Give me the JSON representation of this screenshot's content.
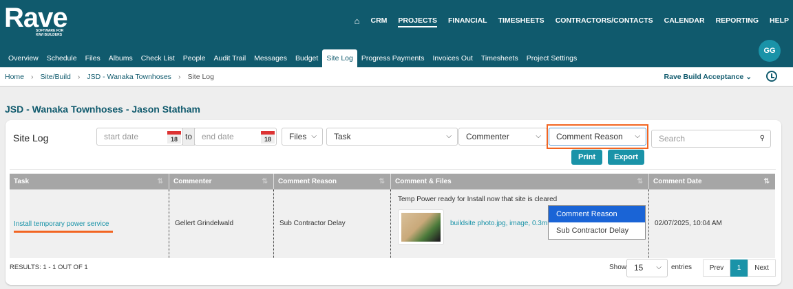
{
  "header": {
    "logo": "Rave",
    "logo_tagline": "SOFTWARE FOR KIWI BUILDERS",
    "top_nav": [
      "CRM",
      "PROJECTS",
      "FINANCIAL",
      "TIMESHEETS",
      "CONTRACTORS/CONTACTS",
      "CALENDAR",
      "REPORTING",
      "HELP"
    ],
    "active_top": "PROJECTS",
    "avatar": "GG"
  },
  "tabs": [
    "Overview",
    "Schedule",
    "Files",
    "Albums",
    "Check List",
    "People",
    "Audit Trail",
    "Messages",
    "Budget",
    "Site Log",
    "Progress Payments",
    "Invoices Out",
    "Timesheets",
    "Project Settings"
  ],
  "breadcrumb": [
    "Home",
    "Site/Build",
    "JSD - Wanaka Townhoses",
    "Site Log"
  ],
  "project_selector": "Rave Build Acceptance",
  "page_title": "JSD - Wanaka Townhoses - Jason Statham",
  "site_log": {
    "title": "Site Log",
    "start_placeholder": "start date",
    "to": "to",
    "end_placeholder": "end date",
    "cal_day": "18",
    "files": "Files",
    "task": "Task",
    "commenter": "Commenter",
    "comment_reason": "Comment Reason",
    "search_placeholder": "Search",
    "print": "Print",
    "export": "Export"
  },
  "table": {
    "headers": [
      "Task",
      "Commenter",
      "Comment Reason",
      "Comment & Files",
      "Comment Date"
    ],
    "row": {
      "task": "Install temporary power service",
      "commenter": "Gellert Grindelwald",
      "reason": "Sub Contractor Delay",
      "comment": "Temp Power ready for Install now that site is cleared",
      "file": "buildsite photo.jpg, image, 0.3mb",
      "date": "02/07/2025, 10:04 AM"
    }
  },
  "dropdown": {
    "options": [
      "Comment Reason",
      "Sub Contractor Delay"
    ]
  },
  "footer": {
    "results": "RESULTS: 1 - 1 OUT OF 1",
    "show": "Show",
    "entries_value": "15",
    "entries": "entries",
    "prev": "Prev",
    "page": "1",
    "next": "Next"
  },
  "colors": {
    "header": "#105a6d",
    "accent": "#1a93a8",
    "highlight": "#f26522"
  }
}
